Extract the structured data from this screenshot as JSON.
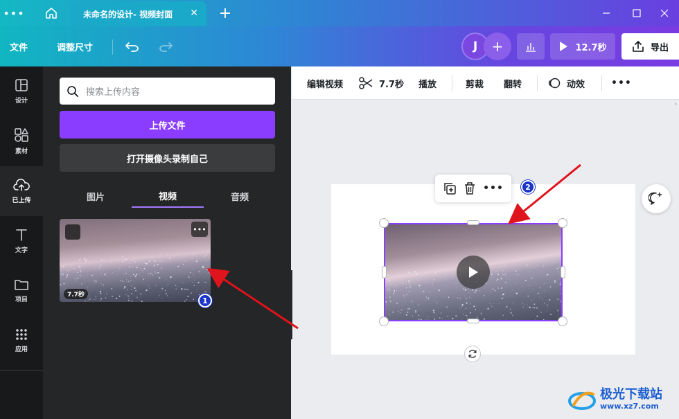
{
  "window": {
    "tab_title": "未命名的设计- 视频封面"
  },
  "toolbar": {
    "file_label": "文件",
    "resize_label": "调整尺寸",
    "avatar_initial": "J",
    "play_duration": "12.7秒",
    "export_label": "导出"
  },
  "rail": {
    "items": [
      {
        "label": "设计",
        "icon": "layout-icon"
      },
      {
        "label": "素材",
        "icon": "shapes-icon"
      },
      {
        "label": "已上传",
        "icon": "cloud-upload-icon"
      },
      {
        "label": "文字",
        "icon": "text-icon"
      },
      {
        "label": "项目",
        "icon": "folder-icon"
      },
      {
        "label": "应用",
        "icon": "apps-grid-icon"
      }
    ]
  },
  "panel": {
    "search_placeholder": "搜索上传内容",
    "upload_label": "上传文件",
    "record_label": "打开摄像头录制自己",
    "tabs": [
      "图片",
      "视频",
      "音频"
    ],
    "active_tab": "视频",
    "video_duration": "7.7秒"
  },
  "edit_bar": {
    "edit_video": "编辑视频",
    "trim_duration": "7.7秒",
    "playback": "播放",
    "crop": "剪裁",
    "flip": "翻转",
    "animate": "动效"
  },
  "annotations": {
    "badge_1": "1",
    "badge_2": "2",
    "arrow_color": "#e0141c"
  },
  "watermark": {
    "text": "极光下载站",
    "url": "www.xz7.com"
  },
  "colors": {
    "accent": "#8b3dff",
    "badge": "#1c36c8"
  }
}
